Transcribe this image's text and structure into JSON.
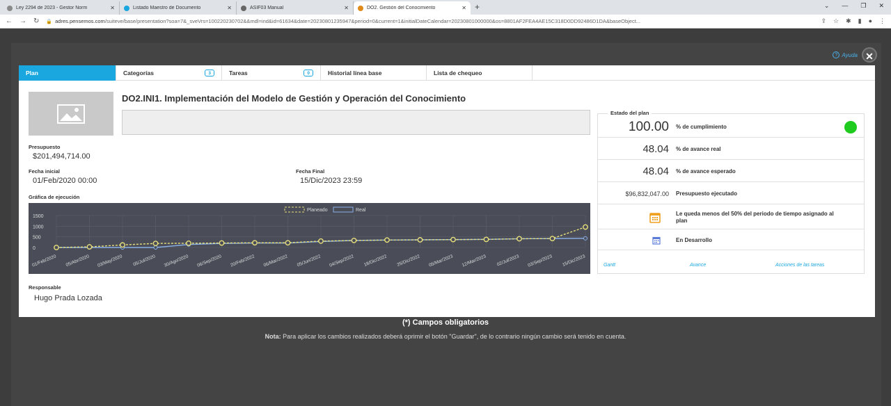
{
  "browser": {
    "tabs": [
      {
        "title": "Ley 2294 de 2023 - Gestor Norm",
        "color": "#8a8a8a"
      },
      {
        "title": "Listado Maestro de Documento",
        "color": "#1aa7e0"
      },
      {
        "title": "ASIF03 Manual",
        "color": "#666666"
      },
      {
        "title": "DO2. Gestión del Conocimiento",
        "color": "#e08a1a"
      }
    ],
    "url_host": "adres.pensemos.com",
    "url_path": "/suiteve/base/presentation?soa=7&_sveVrs=100220230702&&mdl=ind&id=61634&date=20230801235947&period=0&current=1&initialDateCalendar=20230801000000&os=8801AF2FEA4AE15C318D0DD92486D1DA&baseObject..."
  },
  "modal": {
    "help_label": "Ayuda",
    "tabs": [
      {
        "label": "Plan"
      },
      {
        "label": "Categorías",
        "count": "3"
      },
      {
        "label": "Tareas",
        "count": "0"
      },
      {
        "label": "Historial línea base"
      },
      {
        "label": "Lista de chequeo"
      }
    ],
    "plan_title": "DO2.INI1. Implementación del Modelo de Gestión y Operación del Conocimiento",
    "presupuesto_label": "Presupuesto",
    "presupuesto_value": "$201,494,714.00",
    "fecha_inicial_label": "Fecha inicial",
    "fecha_inicial_value": "01/Feb/2020 00:00",
    "fecha_final_label": "Fecha Final",
    "fecha_final_value": "15/Dic/2023 23:59",
    "grafica_label": "Gráfica de ejecución",
    "responsable_label": "Responsable",
    "responsable_value": "Hugo Prada Lozada",
    "estado": {
      "legend": "Estado del plan",
      "cumplimiento_value": "100.00",
      "cumplimiento_label": "% de cumplimiento",
      "status_color": "#1ecb1e",
      "avance_real_value": "48.04",
      "avance_real_label": "% de avance real",
      "avance_esperado_value": "48.04",
      "avance_esperado_label": "% de avance esperado",
      "presupuesto_ejec_value": "$96,832,047.00",
      "presupuesto_ejec_label": "Presupuesto ejecutado",
      "periodo_msg": "Le queda menos del 50% del periodo de tiempo asignado al plan",
      "estado_text": "En Desarrollo",
      "link_gantt": "Gantt",
      "link_avance": "Avance",
      "link_acciones": "Acciones de las tareas"
    }
  },
  "footer": {
    "title": "(*) Campos obligatorios",
    "note_prefix": "Nota:",
    "note_text": "Para aplicar los cambios realizados deberá oprimir el botón \"Guardar\", de lo contrario ningún cambio será tenido en cuenta."
  },
  "chart_data": {
    "type": "line",
    "ylim": [
      0,
      1500
    ],
    "yticks": [
      0,
      500,
      1000,
      1500
    ],
    "categories": [
      "01/Feb/2020",
      "05/Abr/2020",
      "03/May/2020",
      "05/Jul/2020",
      "30/Ago/2020",
      "06/Sep/2020",
      "20/Feb/2022",
      "06/Mar/2022",
      "05/Jun/2022",
      "04/Sep/2022",
      "18/Dic/2022",
      "25/Dic/2022",
      "05/Mar/2023",
      "12/Mar/2023",
      "02/Jul/2023",
      "03/Sep/2023",
      "15/Dic/2023"
    ],
    "series": [
      {
        "name": "Planeado",
        "color": "#e8e07a",
        "values": [
          0,
          30,
          120,
          190,
          200,
          210,
          220,
          220,
          300,
          330,
          350,
          360,
          370,
          380,
          410,
          420,
          960
        ]
      },
      {
        "name": "Real",
        "color": "#8ab0e8",
        "values": [
          0,
          0,
          0,
          0,
          140,
          190,
          210,
          210,
          280,
          330,
          350,
          360,
          370,
          380,
          410,
          420,
          430
        ]
      }
    ]
  }
}
